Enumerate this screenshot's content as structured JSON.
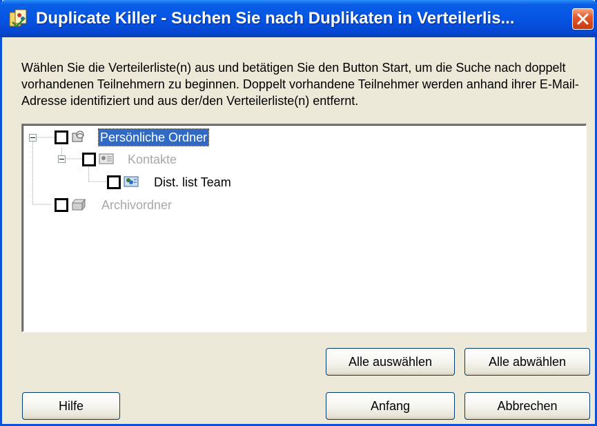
{
  "window": {
    "title": "Duplicate Killer - Suchen Sie nach Duplikaten in Verteilerlis...",
    "icon": "duplicate-killer-app-icon",
    "close_icon": "close-icon"
  },
  "description": "Wählen Sie die Verteilerliste(n) aus und betätigen Sie den Button Start, um die Suche nach doppelt vorhandenen Teilnehmern zu beginnen. Doppelt vorhandene Teilnehmer werden anhand ihrer E-Mail-Adresse identifiziert und aus der/den Verteilerliste(n) entfernt.",
  "tree": {
    "nodes": [
      {
        "label": "Persönliche Ordner",
        "icon": "personal-folders-icon",
        "checked": false,
        "expanded": true,
        "selected": true,
        "disabled": false
      },
      {
        "label": "Kontakte",
        "icon": "contacts-folder-icon",
        "checked": false,
        "expanded": true,
        "selected": false,
        "disabled": true
      },
      {
        "label": "Dist. list Team",
        "icon": "distribution-list-icon",
        "checked": false,
        "selected": false,
        "disabled": false
      },
      {
        "label": "Archivordner",
        "icon": "archive-folder-icon",
        "checked": false,
        "selected": false,
        "disabled": true
      }
    ]
  },
  "buttons": {
    "select_all": "Alle auswählen",
    "deselect_all": "Alle abwählen",
    "help": "Hilfe",
    "start": "Anfang",
    "cancel": "Abbrechen"
  },
  "colors": {
    "titlebar": "#0554e3",
    "selection": "#316ac5",
    "disabled_text": "#a8a8a8",
    "close_button": "#e15a2e",
    "dialog_background": "#ece9d8"
  }
}
